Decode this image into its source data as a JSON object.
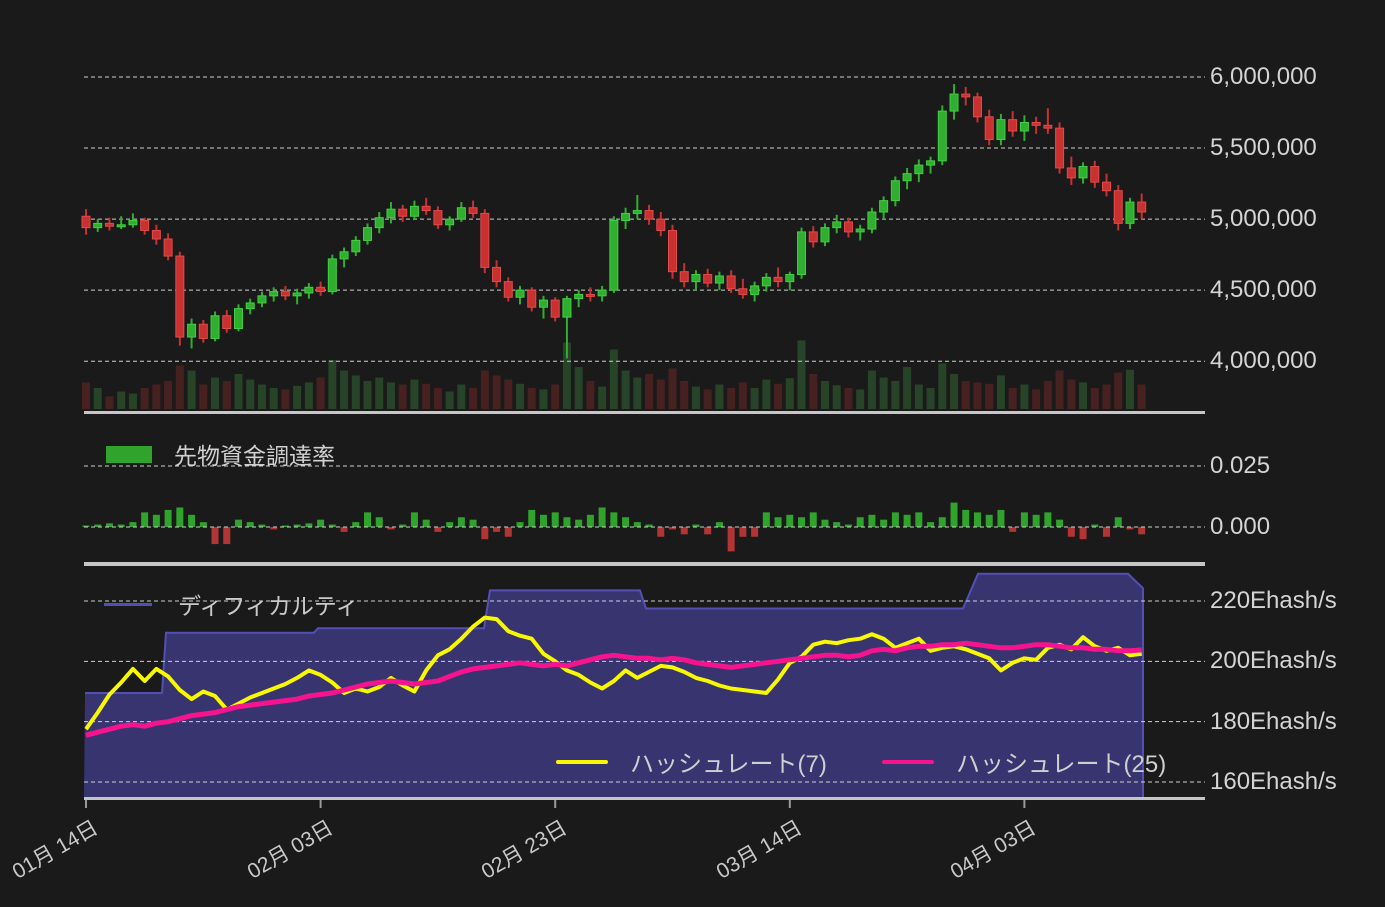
{
  "page": {
    "background": "#1a1a1a"
  },
  "colors": {
    "candle_up": "#2fae2f",
    "candle_up_edge": "#43cf43",
    "candle_down": "#c93131",
    "candle_down_edge": "#e14b4b",
    "volume_up": "rgba(76,175,80,0.28)",
    "volume_down": "rgba(229,57,53,0.22)",
    "funding_up": "#2fa32c",
    "funding_down": "#b23535",
    "difficulty_fill": "#373470",
    "difficulty_edge": "#544fb5",
    "hashrate7": "#f8f800",
    "hashrate25": "#f5148e",
    "gridline": "#cfcfcf",
    "axis_line": "#c6c6c6",
    "tick": "#9a9a9a"
  },
  "x_axis": {
    "tick_labels": [
      "01月 14日",
      "02月 03日",
      "02月 23日",
      "03月 14日",
      "04月 03日"
    ],
    "tick_indices": [
      0,
      20,
      40,
      60,
      80
    ]
  },
  "chart_data": [
    {
      "type": "candlestick",
      "name": "price",
      "unit": "JPY (millions)",
      "y_axis_labels": [
        "6,000,000",
        "5,500,000",
        "5,000,000",
        "4,500,000",
        "4,000,000"
      ],
      "y_axis_values": [
        6.0,
        5.5,
        5.0,
        4.5,
        4.0
      ],
      "ylim": [
        3.75,
        6.12
      ],
      "grid": true,
      "candles_ohlc": [
        [
          5.02,
          5.07,
          4.89,
          4.94
        ],
        [
          4.94,
          5.0,
          4.91,
          4.97
        ],
        [
          4.97,
          5.01,
          4.92,
          4.95
        ],
        [
          4.95,
          5.02,
          4.93,
          4.96
        ],
        [
          4.96,
          5.04,
          4.94,
          4.99
        ],
        [
          4.99,
          5.01,
          4.89,
          4.92
        ],
        [
          4.92,
          4.96,
          4.82,
          4.86
        ],
        [
          4.86,
          4.9,
          4.71,
          4.74
        ],
        [
          4.74,
          4.77,
          4.11,
          4.17
        ],
        [
          4.17,
          4.3,
          4.09,
          4.26
        ],
        [
          4.26,
          4.29,
          4.13,
          4.16
        ],
        [
          4.16,
          4.35,
          4.14,
          4.32
        ],
        [
          4.32,
          4.36,
          4.2,
          4.23
        ],
        [
          4.23,
          4.4,
          4.21,
          4.37
        ],
        [
          4.37,
          4.44,
          4.33,
          4.41
        ],
        [
          4.41,
          4.49,
          4.38,
          4.46
        ],
        [
          4.46,
          4.52,
          4.42,
          4.49
        ],
        [
          4.49,
          4.53,
          4.43,
          4.46
        ],
        [
          4.46,
          4.51,
          4.4,
          4.48
        ],
        [
          4.48,
          4.55,
          4.44,
          4.52
        ],
        [
          4.52,
          4.56,
          4.46,
          4.49
        ],
        [
          4.49,
          4.75,
          4.47,
          4.72
        ],
        [
          4.72,
          4.8,
          4.66,
          4.77
        ],
        [
          4.77,
          4.88,
          4.74,
          4.85
        ],
        [
          4.85,
          4.97,
          4.82,
          4.94
        ],
        [
          4.94,
          5.05,
          4.9,
          5.01
        ],
        [
          5.01,
          5.12,
          4.97,
          5.07
        ],
        [
          5.07,
          5.1,
          4.98,
          5.02
        ],
        [
          5.02,
          5.13,
          5.0,
          5.09
        ],
        [
          5.09,
          5.15,
          5.03,
          5.06
        ],
        [
          5.06,
          5.09,
          4.93,
          4.96
        ],
        [
          4.96,
          5.02,
          4.92,
          5.0
        ],
        [
          5.0,
          5.12,
          4.98,
          5.08
        ],
        [
          5.08,
          5.13,
          5.01,
          5.04
        ],
        [
          5.04,
          5.07,
          4.62,
          4.66
        ],
        [
          4.66,
          4.71,
          4.52,
          4.56
        ],
        [
          4.56,
          4.59,
          4.42,
          4.45
        ],
        [
          4.45,
          4.53,
          4.4,
          4.5
        ],
        [
          4.5,
          4.52,
          4.35,
          4.38
        ],
        [
          4.38,
          4.46,
          4.3,
          4.43
        ],
        [
          4.43,
          4.45,
          4.28,
          4.31
        ],
        [
          4.31,
          4.46,
          4.02,
          4.44
        ],
        [
          4.44,
          4.5,
          4.38,
          4.47
        ],
        [
          4.47,
          4.52,
          4.42,
          4.46
        ],
        [
          4.46,
          4.53,
          4.42,
          4.5
        ],
        [
          4.5,
          5.02,
          4.48,
          4.99
        ],
        [
          4.99,
          5.08,
          4.93,
          5.04
        ],
        [
          5.04,
          5.17,
          5.0,
          5.06
        ],
        [
          5.06,
          5.1,
          4.96,
          5.0
        ],
        [
          5.0,
          5.05,
          4.88,
          4.92
        ],
        [
          4.92,
          4.96,
          4.58,
          4.63
        ],
        [
          4.63,
          4.69,
          4.52,
          4.56
        ],
        [
          4.56,
          4.64,
          4.5,
          4.61
        ],
        [
          4.61,
          4.65,
          4.52,
          4.55
        ],
        [
          4.55,
          4.63,
          4.5,
          4.6
        ],
        [
          4.6,
          4.64,
          4.48,
          4.51
        ],
        [
          4.51,
          4.58,
          4.44,
          4.47
        ],
        [
          4.47,
          4.56,
          4.42,
          4.53
        ],
        [
          4.53,
          4.62,
          4.49,
          4.59
        ],
        [
          4.59,
          4.66,
          4.52,
          4.56
        ],
        [
          4.56,
          4.63,
          4.5,
          4.61
        ],
        [
          4.61,
          4.94,
          4.58,
          4.91
        ],
        [
          4.91,
          4.95,
          4.8,
          4.84
        ],
        [
          4.84,
          4.97,
          4.81,
          4.94
        ],
        [
          4.94,
          5.03,
          4.9,
          4.98
        ],
        [
          4.98,
          5.01,
          4.87,
          4.91
        ],
        [
          4.91,
          4.96,
          4.85,
          4.93
        ],
        [
          4.93,
          5.08,
          4.9,
          5.05
        ],
        [
          5.05,
          5.16,
          5.0,
          5.13
        ],
        [
          5.13,
          5.3,
          5.09,
          5.27
        ],
        [
          5.27,
          5.36,
          5.21,
          5.32
        ],
        [
          5.32,
          5.42,
          5.26,
          5.38
        ],
        [
          5.38,
          5.44,
          5.32,
          5.41
        ],
        [
          5.41,
          5.8,
          5.38,
          5.76
        ],
        [
          5.76,
          5.95,
          5.7,
          5.88
        ],
        [
          5.88,
          5.93,
          5.8,
          5.86
        ],
        [
          5.86,
          5.89,
          5.68,
          5.72
        ],
        [
          5.72,
          5.77,
          5.52,
          5.56
        ],
        [
          5.56,
          5.74,
          5.52,
          5.7
        ],
        [
          5.7,
          5.76,
          5.58,
          5.62
        ],
        [
          5.62,
          5.73,
          5.55,
          5.68
        ],
        [
          5.68,
          5.72,
          5.6,
          5.66
        ],
        [
          5.66,
          5.78,
          5.6,
          5.64
        ],
        [
          5.64,
          5.68,
          5.32,
          5.36
        ],
        [
          5.36,
          5.44,
          5.24,
          5.29
        ],
        [
          5.29,
          5.4,
          5.25,
          5.37
        ],
        [
          5.37,
          5.41,
          5.22,
          5.26
        ],
        [
          5.26,
          5.32,
          5.16,
          5.2
        ],
        [
          5.2,
          5.24,
          4.92,
          4.97
        ],
        [
          4.97,
          5.15,
          4.93,
          5.12
        ],
        [
          5.12,
          5.18,
          5.0,
          5.05
        ]
      ],
      "volume_relative": [
        0.38,
        0.3,
        0.18,
        0.25,
        0.22,
        0.3,
        0.35,
        0.4,
        0.62,
        0.55,
        0.35,
        0.45,
        0.4,
        0.5,
        0.42,
        0.35,
        0.3,
        0.28,
        0.33,
        0.38,
        0.45,
        0.7,
        0.55,
        0.48,
        0.4,
        0.45,
        0.38,
        0.35,
        0.42,
        0.36,
        0.3,
        0.25,
        0.35,
        0.3,
        0.55,
        0.48,
        0.42,
        0.36,
        0.3,
        0.28,
        0.35,
        0.95,
        0.6,
        0.4,
        0.32,
        0.85,
        0.55,
        0.45,
        0.5,
        0.42,
        0.58,
        0.4,
        0.32,
        0.28,
        0.35,
        0.3,
        0.38,
        0.3,
        0.42,
        0.36,
        0.44,
        0.98,
        0.5,
        0.4,
        0.34,
        0.3,
        0.28,
        0.55,
        0.45,
        0.4,
        0.6,
        0.35,
        0.3,
        0.65,
        0.5,
        0.4,
        0.38,
        0.36,
        0.48,
        0.3,
        0.35,
        0.28,
        0.4,
        0.55,
        0.42,
        0.38,
        0.3,
        0.35,
        0.52,
        0.56,
        0.35
      ]
    },
    {
      "type": "bar",
      "name": "funding_rate",
      "legend": "先物資金調達率",
      "y_axis_labels": [
        "0.025",
        "0.000"
      ],
      "y_axis_values": [
        0.025,
        0.0
      ],
      "grid": true,
      "values": [
        0.0005,
        0.001,
        0.0015,
        0.001,
        0.002,
        0.006,
        0.005,
        0.007,
        0.008,
        0.005,
        0.002,
        -0.007,
        -0.007,
        0.003,
        0.002,
        0.001,
        -0.001,
        0.0005,
        0.001,
        0.0015,
        0.003,
        0.001,
        -0.002,
        0.002,
        0.006,
        0.004,
        -0.001,
        0.001,
        0.006,
        0.003,
        -0.002,
        0.002,
        0.004,
        0.003,
        -0.005,
        -0.002,
        -0.004,
        0.002,
        0.007,
        0.005,
        0.006,
        0.004,
        0.003,
        0.005,
        0.008,
        0.006,
        0.004,
        0.002,
        0.001,
        -0.004,
        -0.001,
        -0.003,
        0.001,
        -0.003,
        0.002,
        -0.01,
        -0.004,
        -0.004,
        0.006,
        0.004,
        0.005,
        0.004,
        0.006,
        0.003,
        0.002,
        0.001,
        0.004,
        0.005,
        0.003,
        0.006,
        0.005,
        0.006,
        0.002,
        0.004,
        0.01,
        0.007,
        0.006,
        0.005,
        0.007,
        -0.002,
        0.006,
        0.005,
        0.006,
        0.003,
        -0.004,
        -0.005,
        0.001,
        -0.004,
        0.004,
        -0.001,
        -0.003
      ]
    },
    {
      "type": "line+area",
      "name": "hashrate_difficulty",
      "area_legend": "ディフィカルティ",
      "y_axis_labels": [
        "220Ehash/s",
        "200Ehash/s",
        "180Ehash/s",
        "160Ehash/s"
      ],
      "y_axis_values": [
        220,
        200,
        180,
        160
      ],
      "ylim": [
        155,
        235
      ],
      "grid": true,
      "legend_position": "bottom-center",
      "difficulty_step_top_points": [
        [
          85,
          189.5
        ],
        [
          162,
          189.5
        ],
        [
          166,
          209.5
        ],
        [
          314,
          209.5
        ],
        [
          318,
          211
        ],
        [
          484,
          211
        ],
        [
          490,
          223.5
        ],
        [
          640,
          223.5
        ],
        [
          646,
          217.5
        ],
        [
          963,
          217.5
        ],
        [
          978,
          229
        ],
        [
          1128,
          229
        ],
        [
          1143,
          224.2
        ]
      ],
      "series": [
        {
          "name": "ハッシュレート(7)",
          "color": "#f8f800",
          "values": [
            177.5,
            183,
            189,
            193,
            197.5,
            193.5,
            197.5,
            195,
            190.5,
            187.5,
            190,
            188.5,
            184,
            186,
            188,
            189.5,
            191,
            192.5,
            194.5,
            197,
            195.5,
            193,
            189.5,
            191,
            190,
            191.5,
            194.5,
            192,
            190,
            197,
            202,
            204,
            207.5,
            211.5,
            214.5,
            214,
            210,
            208.5,
            207.5,
            202.5,
            200,
            197,
            195.5,
            193,
            191,
            193.5,
            197,
            194.5,
            196.5,
            198.5,
            198,
            196.5,
            194.5,
            193.5,
            192,
            191,
            190.5,
            190,
            189.5,
            194,
            199.5,
            201.5,
            205.5,
            206.5,
            206,
            207,
            207.5,
            209,
            207.5,
            204.5,
            206,
            207.5,
            203.5,
            204.5,
            205,
            204,
            202.5,
            201,
            197,
            199.5,
            201,
            200.5,
            204.5,
            205.5,
            204,
            208,
            205,
            203.5,
            204.5,
            202,
            202.5
          ]
        },
        {
          "name": "ハッシュレート(25)",
          "color": "#f5148e",
          "values": [
            175.5,
            176.5,
            177.5,
            178.5,
            179,
            178.5,
            179.5,
            180,
            181,
            182,
            182.5,
            183,
            184,
            185,
            185.5,
            186,
            186.5,
            187,
            187.5,
            188.5,
            189,
            189.5,
            190.5,
            191.5,
            192.5,
            193,
            193.5,
            193,
            192.5,
            193,
            193.5,
            195,
            196.5,
            197.5,
            198,
            198.5,
            199,
            199.5,
            199,
            198.5,
            199,
            198.5,
            199.5,
            200.5,
            201.5,
            202,
            201.5,
            201,
            201,
            200.5,
            201,
            200.5,
            199.5,
            199,
            198.5,
            198,
            198.5,
            199,
            199.5,
            200,
            200.5,
            201,
            201.5,
            202,
            202,
            201.5,
            202,
            203.5,
            204,
            203.5,
            204.5,
            205,
            205,
            205.5,
            205.5,
            206,
            205.5,
            205,
            204.5,
            204.5,
            205,
            205.5,
            205.5,
            205,
            204.5,
            204.5,
            204,
            204,
            203.5,
            203.5,
            203.8
          ]
        }
      ]
    }
  ]
}
